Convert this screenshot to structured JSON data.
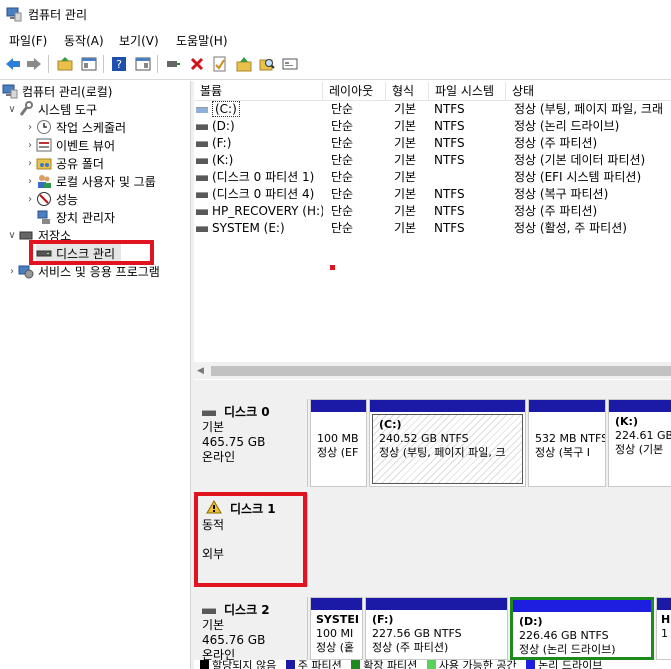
{
  "window": {
    "title": "컴퓨터 관리"
  },
  "menu": [
    "파일(F)",
    "동작(A)",
    "보기(V)",
    "도움말(H)"
  ],
  "toolbar": [
    "back-icon",
    "forward-icon",
    "up-folder-icon",
    "show-hide-tree-icon",
    "help-icon",
    "properties-pane-icon",
    "connect-icon",
    "delete-icon",
    "check-icon",
    "folder-up-icon",
    "search-icon",
    "window-icon"
  ],
  "tree": {
    "root": "컴퓨터 관리(로컬)",
    "system_tools": "시스템 도구",
    "task_scheduler": "작업 스케줄러",
    "event_viewer": "이벤트 뷰어",
    "shared_folders": "공유 폴더",
    "local_users": "로컬 사용자 및 그룹",
    "performance": "성능",
    "device_manager": "장치 관리자",
    "storage": "저장소",
    "disk_management": "디스크 관리",
    "services": "서비스 및 응용 프로그램"
  },
  "columns": [
    "볼륨",
    "레이아웃",
    "형식",
    "파일 시스템",
    "상태"
  ],
  "volumes": [
    {
      "name": "(C:)",
      "layout": "단순",
      "type": "기본",
      "fs": "NTFS",
      "status": "정상 (부팅, 페이지 파일, 크래"
    },
    {
      "name": "(D:)",
      "layout": "단순",
      "type": "기본",
      "fs": "NTFS",
      "status": "정상 (논리 드라이브)"
    },
    {
      "name": "(F:)",
      "layout": "단순",
      "type": "기본",
      "fs": "NTFS",
      "status": "정상 (주 파티션)"
    },
    {
      "name": "(K:)",
      "layout": "단순",
      "type": "기본",
      "fs": "NTFS",
      "status": "정상 (기본 데이터 파티션)"
    },
    {
      "name": "(디스크 0 파티션 1)",
      "layout": "단순",
      "type": "기본",
      "fs": "",
      "status": "정상 (EFI 시스템 파티션)"
    },
    {
      "name": "(디스크 0 파티션 4)",
      "layout": "단순",
      "type": "기본",
      "fs": "NTFS",
      "status": "정상 (복구 파티션)"
    },
    {
      "name": "HP_RECOVERY (H:)",
      "layout": "단순",
      "type": "기본",
      "fs": "NTFS",
      "status": "정상 (주 파티션)"
    },
    {
      "name": "SYSTEM (E:)",
      "layout": "단순",
      "type": "기본",
      "fs": "NTFS",
      "status": "정상 (활성, 주 파티션)"
    }
  ],
  "disks": [
    {
      "name": "디스크 0",
      "kind": "기본",
      "size": "465.75 GB",
      "state": "온라인",
      "partitions": [
        {
          "l1": "100 MB",
          "l2": "정상 (EF"
        },
        {
          "l1": "(C:)",
          "l2": "240.52 GB NTFS",
          "l3": "정상 (부팅, 페이지 파일, 크"
        },
        {
          "l1": "532 MB NTFS",
          "l2": "정상 (복구 I"
        },
        {
          "l1": "(K:)",
          "l2": "224.61 GB",
          "l3": "정상 (기본"
        }
      ]
    },
    {
      "name": "디스크 1",
      "kind": "동적",
      "size": "",
      "state": "외부",
      "partitions": []
    },
    {
      "name": "디스크 2",
      "kind": "기본",
      "size": "465.76 GB",
      "state": "온라인",
      "partitions": [
        {
          "l1": "SYSTEI",
          "l2": "100 MI",
          "l3": "정상 (홑"
        },
        {
          "l1": "(F:)",
          "l2": "227.56 GB NTFS",
          "l3": "정상 (주 파티션)"
        },
        {
          "l1": "(D:)",
          "l2": "226.46 GB NTFS",
          "l3": "정상 (논리 드라이브)"
        },
        {
          "l1": "H",
          "l2": "1",
          "l3": ""
        }
      ]
    }
  ],
  "legend": [
    "할당되지 않음",
    "주 파티션",
    "확장 파티션",
    "사용 가능한 공간",
    "논리 드라이브"
  ],
  "colors": {
    "primary_bar": "#1a1aa6",
    "logical_bar": "#1e1ee0",
    "highlight": "#e0141e",
    "extended": "#1e8a1e",
    "free": "#5ad25a"
  }
}
